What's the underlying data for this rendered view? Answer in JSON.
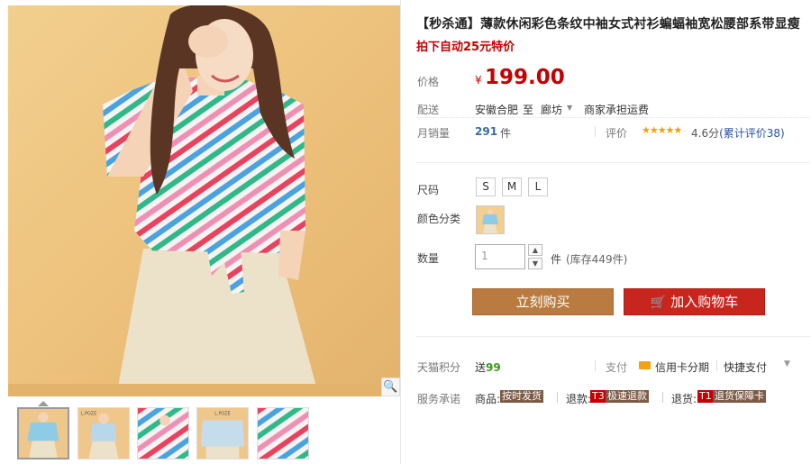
{
  "product": {
    "title": "【秒杀通】薄款休闲彩色条纹中袖女式衬衫蝙蝠袖宽松腰部系带显瘦",
    "promo_text": "拍下自动25元特价",
    "price_label": "价格",
    "currency_symbol": "¥",
    "price": "199.00"
  },
  "delivery": {
    "label": "配送",
    "from": "安徽合肥",
    "to_word": "至",
    "to": "廊坊",
    "shipping_note": "商家承担运费"
  },
  "sales": {
    "label": "月销量",
    "count": "291",
    "unit": "件",
    "rating_label": "评价",
    "stars": "★★★★★",
    "score": "4.6分",
    "reviews": "(累计评价38)"
  },
  "options": {
    "size_label": "尺码",
    "sizes": [
      "S",
      "M",
      "L"
    ],
    "color_label": "颜色分类",
    "quantity_label": "数量",
    "quantity_value": "1",
    "qty_up": "▲",
    "qty_down": "▼",
    "unit": "件",
    "stock": "(库存449件)"
  },
  "actions": {
    "buy_now": "立刻购买",
    "add_to_cart": "加入购物车",
    "cart_icon": "cart-icon"
  },
  "points": {
    "label": "天猫积分",
    "give": "送",
    "amount": "99"
  },
  "payment": {
    "label": "支付",
    "credit_installment": "信用卡分期",
    "quick_pay": "快捷支付",
    "dropdown_icon": "▼"
  },
  "services": {
    "label": "服务承诺",
    "items": [
      {
        "category": "商品:",
        "badge": "按时发货"
      },
      {
        "category": "退款:",
        "code": "T3",
        "badge": "极速退款"
      },
      {
        "category": "退货:",
        "code": "T1",
        "badge": "退货保障卡"
      }
    ]
  },
  "gallery": {
    "zoom_icon": "🔍",
    "thumbnail_brand": "L.POZE",
    "thumbnail_count": 5
  },
  "colors": {
    "price_red": "#c40000",
    "buy_button": "#b97b3f",
    "cart_button": "#c8261d",
    "link_blue": "#2953a6",
    "star_orange": "#f2a100"
  }
}
